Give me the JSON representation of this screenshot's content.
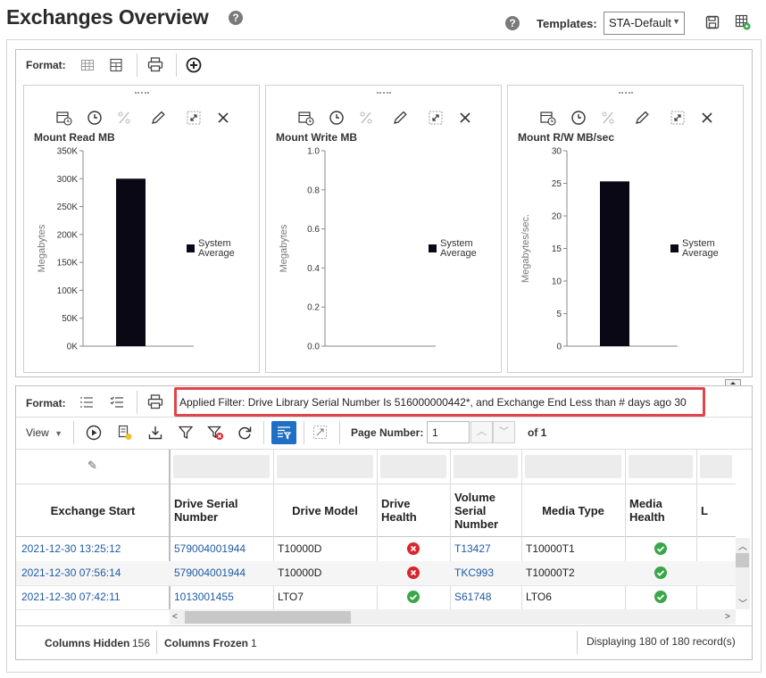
{
  "header": {
    "title": "Exchanges Overview",
    "templates_label": "Templates:",
    "template_selected": "STA-Default",
    "icons": [
      "help-icon",
      "save-icon",
      "export-grid-icon"
    ]
  },
  "charts_toolbar": {
    "format_label": "Format:"
  },
  "charts": [
    {
      "title": "Mount Read MB",
      "ylabel": "Megabytes",
      "ticks": [
        "350K",
        "300K",
        "250K",
        "200K",
        "150K",
        "100K",
        "50K",
        "0K"
      ],
      "legend": [
        "System",
        "Average"
      ]
    },
    {
      "title": "Mount Write MB",
      "ylabel": "Megabytes",
      "ticks": [
        "1.0",
        "0.8",
        "0.6",
        "0.4",
        "0.2",
        "0.0"
      ],
      "legend": [
        "System",
        "Average"
      ]
    },
    {
      "title": "Mount R/W MB/sec",
      "ylabel": "Megabytes/sec.",
      "ticks": [
        "30",
        "25",
        "20",
        "15",
        "10",
        "5",
        "0"
      ],
      "legend": [
        "System",
        "Average"
      ]
    }
  ],
  "chart_data": [
    {
      "type": "bar",
      "categories": [
        ""
      ],
      "series": [
        {
          "name": "System Average",
          "values": [
            300000
          ]
        }
      ],
      "title": "Mount Read MB",
      "ylabel": "Megabytes",
      "ylim": [
        0,
        350000
      ],
      "legend": "right"
    },
    {
      "type": "bar",
      "categories": [
        ""
      ],
      "series": [
        {
          "name": "System Average",
          "values": [
            0
          ]
        }
      ],
      "title": "Mount Write MB",
      "ylabel": "Megabytes",
      "ylim": [
        0,
        1.0
      ],
      "legend": "right"
    },
    {
      "type": "bar",
      "categories": [
        ""
      ],
      "series": [
        {
          "name": "System Average",
          "values": [
            25.3
          ]
        }
      ],
      "title": "Mount R/W MB/sec",
      "ylabel": "Megabytes/sec.",
      "ylim": [
        0,
        30
      ],
      "legend": "right"
    }
  ],
  "table_toolbar": {
    "format_label": "Format:",
    "applied_filter": "Applied Filter: Drive Library Serial Number Is 516000000442*, and Exchange End Less than # days ago 30",
    "view_label": "View",
    "page_number_label": "Page Number:",
    "page_number_value": "1",
    "page_total": "of 1"
  },
  "table": {
    "columns": [
      [
        "Exchange Start"
      ],
      [
        "Drive Serial",
        "Number"
      ],
      [
        "Drive Model"
      ],
      [
        "Drive",
        "Health"
      ],
      [
        "Volume",
        "Serial",
        "Number"
      ],
      [
        "Media Type"
      ],
      [
        "Media",
        "Health"
      ],
      [
        "L"
      ]
    ],
    "rows": [
      {
        "exchange_start": "2021-12-30 13:25:12",
        "drive_serial": "579004001944",
        "drive_model": "T10000D",
        "drive_health": "error",
        "volume_serial": "T13427",
        "media_type": "T10000T1",
        "media_health": "ok"
      },
      {
        "exchange_start": "2021-12-30 07:56:14",
        "drive_serial": "579004001944",
        "drive_model": "T10000D",
        "drive_health": "error",
        "volume_serial": "TKC993",
        "media_type": "T10000T2",
        "media_health": "ok"
      },
      {
        "exchange_start": "2021-12-30 07:42:11",
        "drive_serial": "1013001455",
        "drive_model": "LTO7",
        "drive_health": "ok",
        "volume_serial": "S61748",
        "media_type": "LTO6",
        "media_health": "ok"
      }
    ]
  },
  "footer": {
    "columns_hidden_label": "Columns Hidden",
    "columns_hidden_value": "156",
    "columns_frozen_label": "Columns Frozen",
    "columns_frozen_value": "1",
    "record_status": "Displaying 180 of 180 record(s)"
  },
  "colors": {
    "bar": "#0b0816",
    "filter_highlight": "#e0454b",
    "link": "#1f5aa6",
    "ok": "#3aa64a",
    "error": "#d9262c"
  }
}
